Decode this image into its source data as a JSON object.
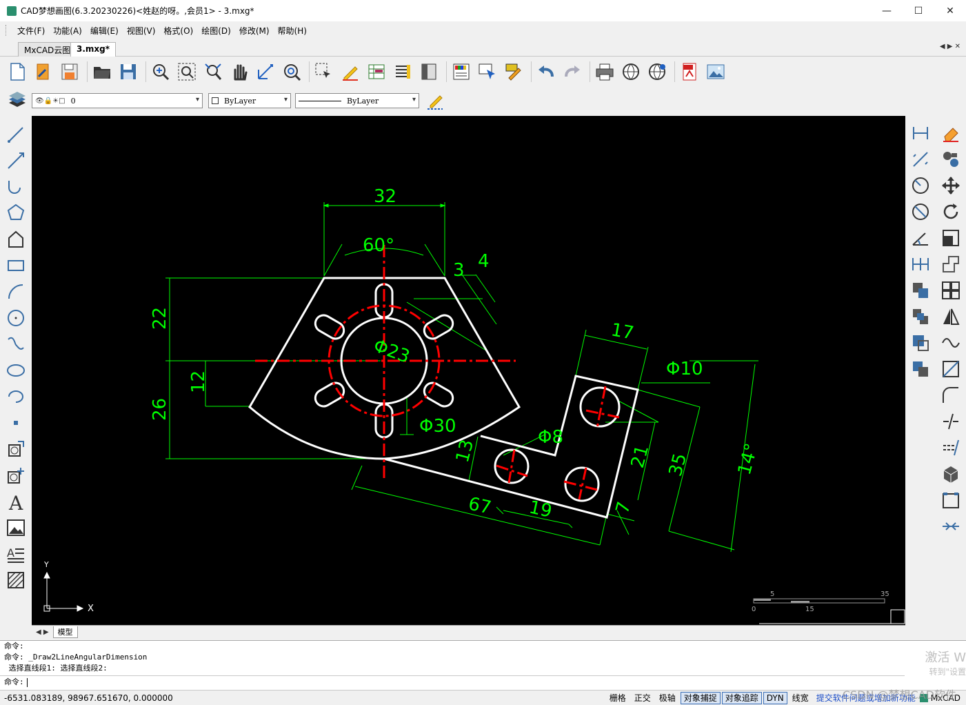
{
  "window": {
    "title": "CAD梦想画图(6.3.20230226)<姓赵的呀。,会员1> - 3.mxg*",
    "minimize": "—",
    "maximize": "☐",
    "close": "✕"
  },
  "menu": [
    "文件(F)",
    "功能(A)",
    "编辑(E)",
    "视图(V)",
    "格式(O)",
    "绘图(D)",
    "修改(M)",
    "帮助(H)"
  ],
  "tabs": [
    {
      "label": "MxCAD云图",
      "active": false
    },
    {
      "label": "3.mxg*",
      "active": true
    }
  ],
  "tab_nav": "◀ ▶ ✕",
  "toolbar1_icons": [
    "new-icon",
    "open-orange-icon",
    "save-icon",
    "folder-open-icon",
    "save-as-icon",
    "zoom-window-icon",
    "zoom-extents-icon",
    "zoom-realtime-icon",
    "pan-hand-icon",
    "measure-icon",
    "zoom-previous-icon",
    "select-icon",
    "pencil-icon",
    "grid-table-icon",
    "list-icon",
    "properties-icon",
    "color-palette-icon",
    "select-arrow-icon",
    "match-props-icon",
    "undo-icon",
    "redo-icon",
    "print-icon",
    "globe-icon",
    "globe-sync-icon",
    "pdf-icon",
    "image-icon"
  ],
  "layer_bar": {
    "layer_value": "0",
    "color_value": "ByLayer",
    "linetype_value": "ByLayer"
  },
  "left_tools": [
    "line-icon",
    "xline-icon",
    "polyline-arc-icon",
    "polygon-icon",
    "pentagon-icon",
    "rectangle-icon",
    "arc-icon",
    "circle-icon",
    "spline-icon",
    "ellipse-icon",
    "ellipse-arc-icon",
    "point-icon",
    "insert-block-icon",
    "make-block-icon",
    "text-icon",
    "image-insert-icon",
    "mtext-icon",
    "hatch-icon"
  ],
  "right_tools_col1": [
    "dim-linear-icon",
    "dim-aligned-icon",
    "dim-radius-icon",
    "dim-diameter-icon",
    "dim-angle-icon",
    "dim-continue-icon",
    "copy-icon",
    "move-icon",
    "offset-icon",
    "array-icon"
  ],
  "right_tools_col2": [
    "erase-icon",
    "copy-objects-icon",
    "move-cross-icon",
    "rotate-icon",
    "scale-icon",
    "stretch-icon",
    "array-grid-icon",
    "mirror-icon",
    "wave-icon",
    "trim-icon",
    "fillet-icon",
    "break-icon",
    "extend-icon",
    "explode-3d-icon",
    "box-icon",
    "join-icon"
  ],
  "drawing": {
    "dims": {
      "d32": "32",
      "d60": "60°",
      "d3": "3",
      "d4": "4",
      "d22": "22",
      "d12": "12",
      "d26": "26",
      "d23": "Φ23",
      "d30": "Φ30",
      "d17": "17",
      "d10": "Φ10",
      "d8": "Φ8",
      "d13": "13",
      "d21": "21",
      "d35": "35",
      "d14": "14°",
      "d67": "67",
      "d19": "19",
      "d7": "7"
    },
    "ucs": {
      "x": "X",
      "y": "Y"
    },
    "scale": {
      "t5": "5",
      "t35": "35",
      "t0": "0",
      "t15": "15"
    },
    "colors": {
      "geometry": "#ffffff",
      "centerline": "#ff0000",
      "dimension": "#00ff00",
      "background": "#000000"
    }
  },
  "model_tab": "模型",
  "command": {
    "line1": "命令:",
    "line2": "命令: _Draw2LineAngularDimension",
    "line3": " 选择直线段1: 选择直线段2:",
    "prompt": "命令:",
    "watermark1": "激活 W",
    "watermark2": "转到\"设置"
  },
  "status": {
    "coords": "-6531.083189,  98967.651670,  0.000000",
    "buttons": [
      {
        "label": "栅格",
        "on": false
      },
      {
        "label": "正交",
        "on": false
      },
      {
        "label": "极轴",
        "on": false
      },
      {
        "label": "对象捕捉",
        "on": true
      },
      {
        "label": "对象追踪",
        "on": true
      },
      {
        "label": "DYN",
        "on": true
      },
      {
        "label": "线宽",
        "on": false
      }
    ],
    "link": "提交软件问题或增加新功能",
    "brand": "MxCAD",
    "csdn": "CSDN @梦想CAD软件"
  }
}
